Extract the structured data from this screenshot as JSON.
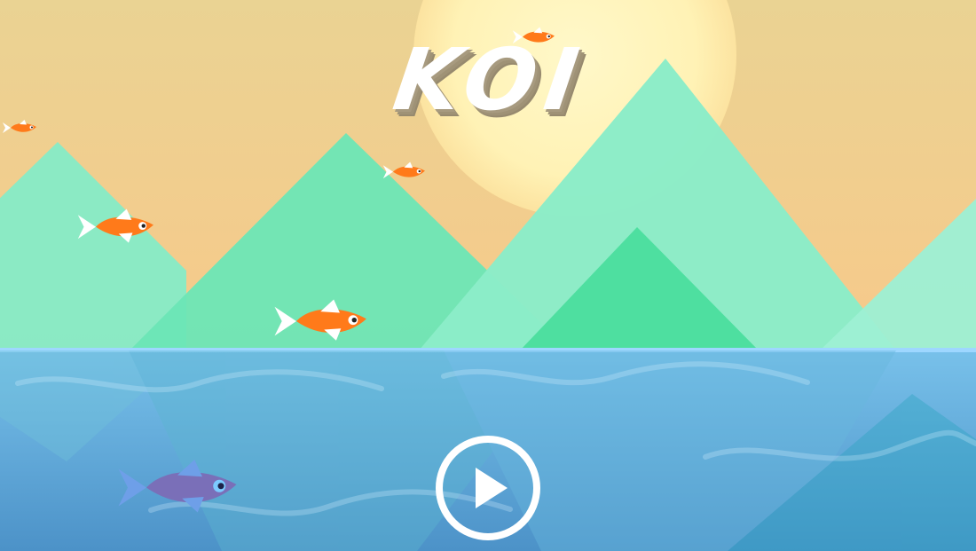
{
  "game": {
    "title": "KOI"
  },
  "colors": {
    "sky_top": "#EAD393",
    "sky_bottom": "#F6C98E",
    "sun": "#FFF4BB",
    "mountain_light": "#9BF0CE",
    "mountain_mid": "#72E6B5",
    "mountain_deep": "#4DE09E",
    "water_top": "#75B9E5",
    "water_bottom": "#4E96C8",
    "waterline": "#9ED7FF",
    "koi_orange": "#FF7A1A",
    "koi_purple": "#7A6FB8",
    "play_button": "#FFFFFF"
  },
  "icons": {
    "play": "play-icon"
  }
}
